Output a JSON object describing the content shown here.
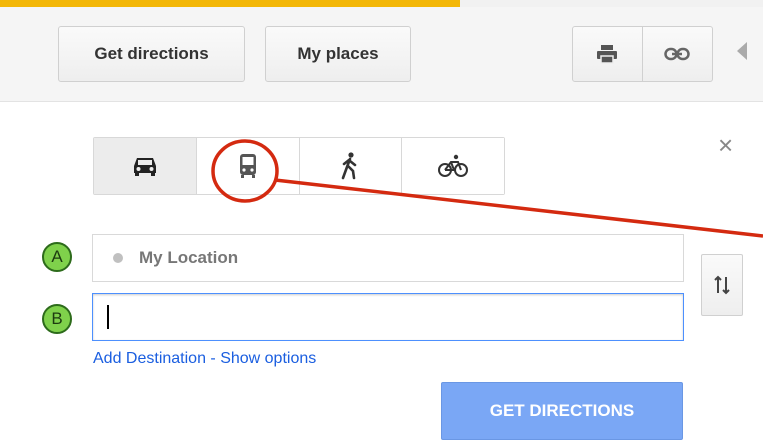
{
  "header": {
    "get_directions_label": "Get directions",
    "my_places_label": "My places",
    "print_icon": "printer-icon",
    "link_icon": "link-icon"
  },
  "travel_modes": [
    {
      "name": "driving",
      "icon": "car-icon",
      "active": true
    },
    {
      "name": "transit",
      "icon": "bus-icon",
      "active": false
    },
    {
      "name": "walking",
      "icon": "walking-icon",
      "active": false
    },
    {
      "name": "bicycling",
      "icon": "bicycle-icon",
      "active": false
    }
  ],
  "route": {
    "start": {
      "marker": "A",
      "value": "My Location"
    },
    "end": {
      "marker": "B",
      "value": "",
      "placeholder": ""
    }
  },
  "links": {
    "add_destination": "Add Destination",
    "separator": " - ",
    "show_options": "Show options"
  },
  "submit_label": "GET DIRECTIONS",
  "colors": {
    "accent_bar": "#f3b707",
    "link": "#1a5ee0",
    "submit_button": "#7aa7f5",
    "marker_fill": "#7fd14b",
    "annotation": "#d42a10"
  }
}
